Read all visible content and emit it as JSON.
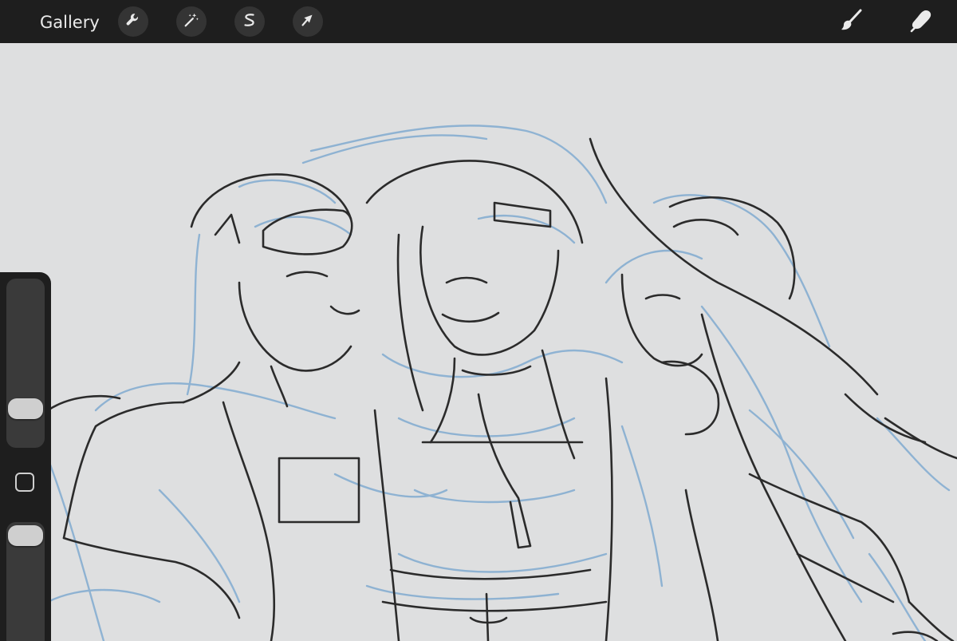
{
  "toolbar": {
    "gallery_label": "Gallery",
    "left_tools": [
      {
        "name": "actions",
        "icon": "wrench-icon"
      },
      {
        "name": "adjustments",
        "icon": "magic-wand-icon"
      },
      {
        "name": "selection",
        "icon": "selection-s-icon"
      },
      {
        "name": "transform",
        "icon": "arrow-cursor-icon"
      }
    ],
    "right_tools": [
      {
        "name": "brush",
        "icon": "brush-icon"
      },
      {
        "name": "smudge",
        "icon": "smudge-finger-icon"
      }
    ]
  },
  "sidebar": {
    "brush_size_slider": {
      "level": 0.82
    },
    "modify_button": {
      "icon": "square-modify-icon"
    },
    "opacity_slider": {
      "level": 0.94
    }
  },
  "canvas": {
    "content": "sketch-drawing",
    "colors": {
      "background": "#dedfe0",
      "ink_lines": "#2b2b2b",
      "sketch_lines": "#86aed1"
    }
  },
  "colors": {
    "toolbar_bg": "#1e1e1e",
    "tool_button_bg": "#343434",
    "icon": "#eaeaea"
  }
}
